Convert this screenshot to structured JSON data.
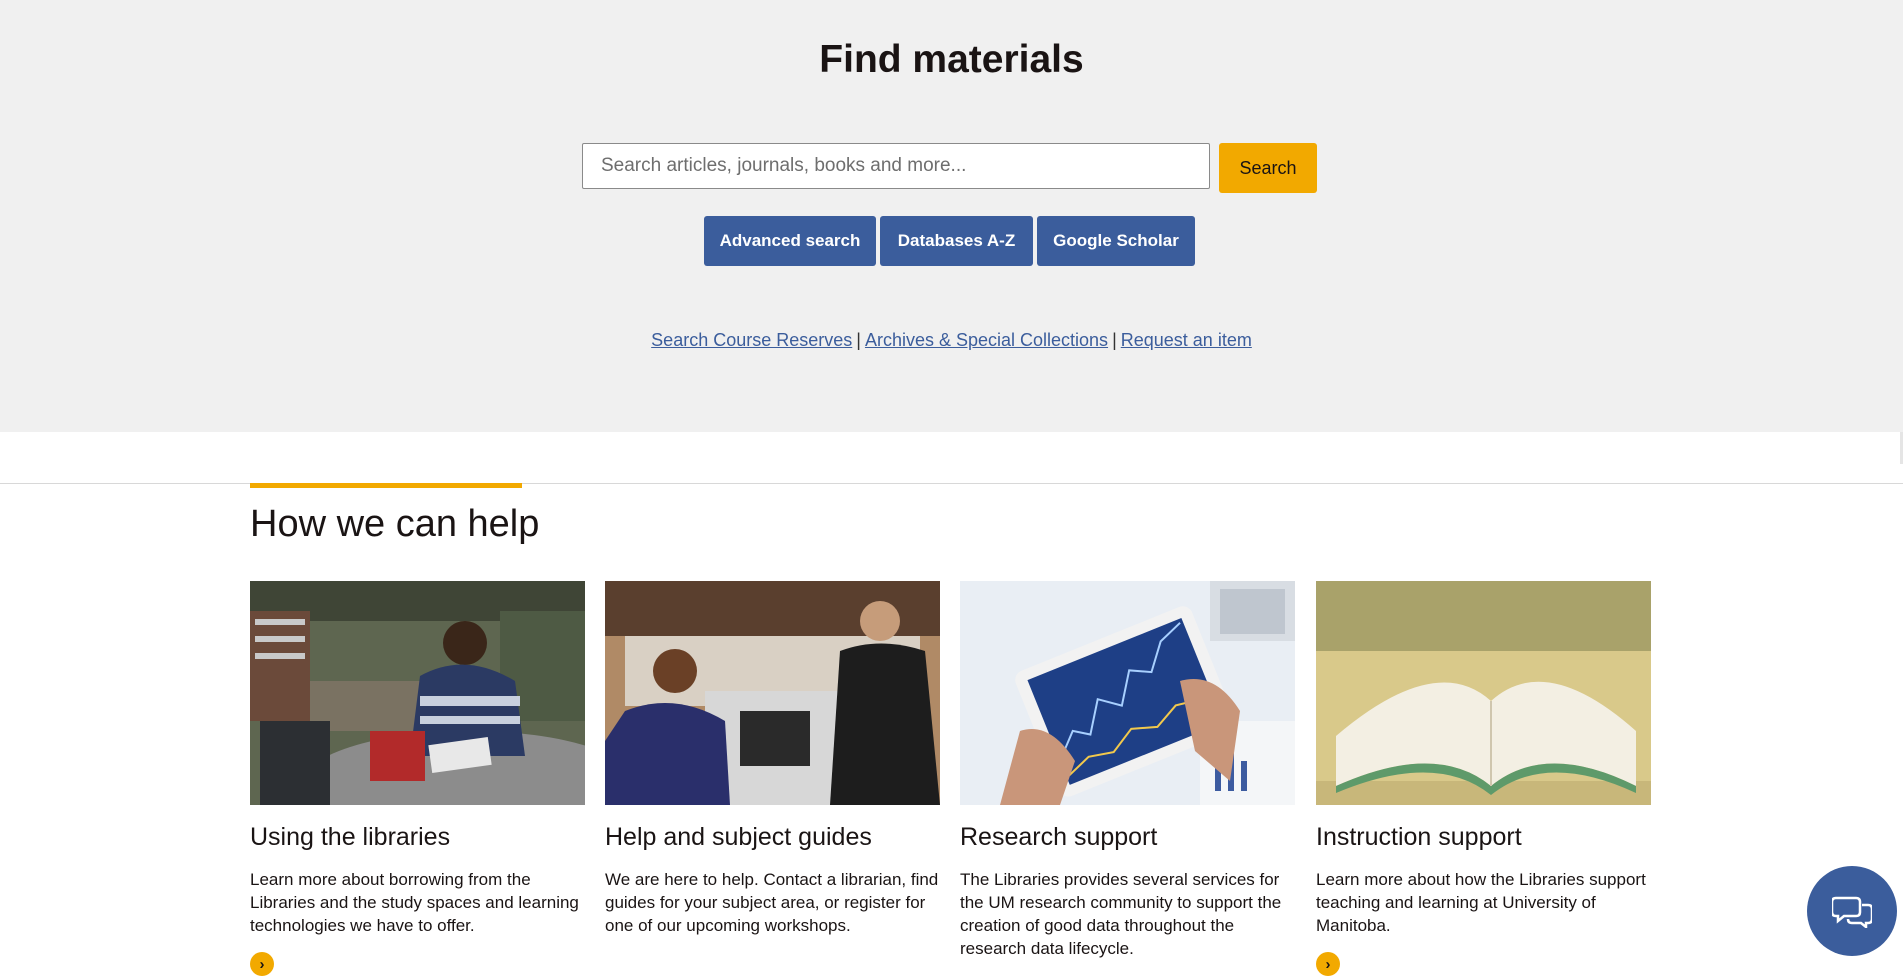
{
  "find": {
    "title": "Find materials",
    "search_placeholder": "Search articles, journals, books and more...",
    "search_button": "Search",
    "quick_buttons": [
      "Advanced search",
      "Databases A-Z",
      "Google Scholar"
    ],
    "links": [
      "Search Course Reserves",
      "Archives & Special Collections",
      "Request an item"
    ],
    "link_separator": "|"
  },
  "help": {
    "heading": "How we can help",
    "cards": [
      {
        "title": "Using the libraries",
        "description": "Learn more about borrowing from the Libraries and the study spaces and learning technologies we have to offer."
      },
      {
        "title": "Help and subject guides",
        "description": "We are here to help. Contact a librarian, find guides for your subject area, or register for one of our upcoming workshops."
      },
      {
        "title": "Research support",
        "description": "The Libraries provides several services for the UM research community to support the creation of good data throughout the research data lifecycle."
      },
      {
        "title": "Instruction support",
        "description": "Learn more about how the Libraries support teaching and learning at University of Manitoba."
      }
    ]
  },
  "chat": {
    "icon": "chat-bubbles-icon"
  },
  "colors": {
    "accent": "#f2a900",
    "brand_blue": "#3b5d9c",
    "band_bg": "#f0f0f0",
    "text": "#1a1414"
  }
}
